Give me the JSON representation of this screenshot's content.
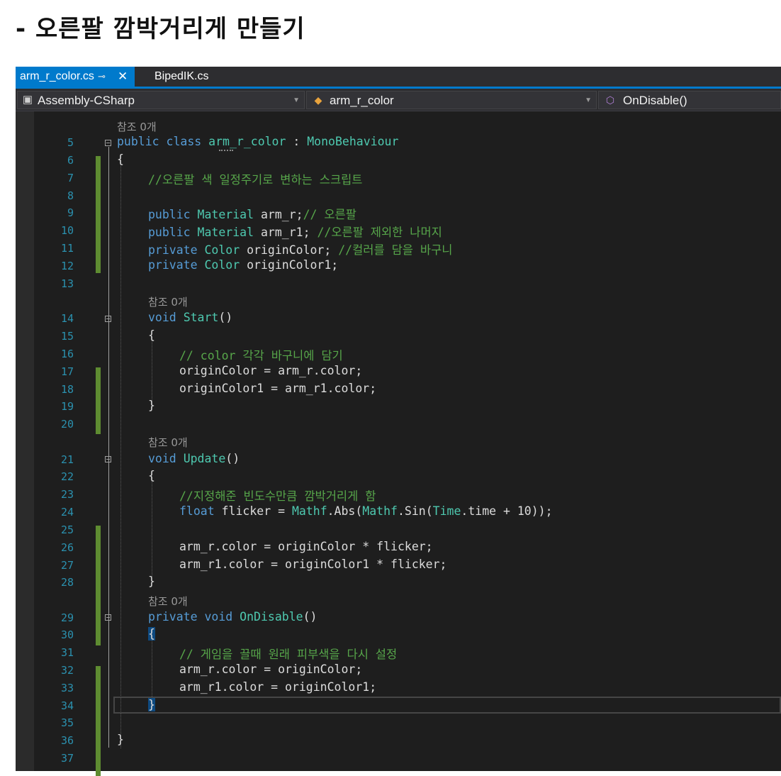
{
  "heading": "- 오른팔 깜박거리게 만들기",
  "tabs": [
    {
      "label": "arm_r_color.cs",
      "pin": "⊸",
      "close": "✕",
      "active": true
    },
    {
      "label": "BipedIK.cs",
      "active": false
    }
  ],
  "nav": {
    "project": "Assembly-CSharp",
    "class": "arm_r_color",
    "member": "OnDisable()"
  },
  "codelens": "참조 0개",
  "line_numbers": [
    "5",
    "6",
    "7",
    "8",
    "9",
    "10",
    "11",
    "12",
    "13",
    "14",
    "15",
    "16",
    "17",
    "18",
    "19",
    "20",
    "21",
    "22",
    "23",
    "24",
    "25",
    "26",
    "27",
    "28",
    "29",
    "30",
    "31",
    "32",
    "33",
    "34",
    "35",
    "36",
    "37"
  ],
  "code": {
    "l5": [
      "public",
      "class",
      "arm_r_color",
      ":",
      "MonoBehaviour"
    ],
    "l6": "{",
    "l7": "//오른팔 색 일정주기로 변하는 스크립트",
    "l9": [
      "public",
      "Material",
      "arm_r;",
      "// 오른팔"
    ],
    "l10": [
      "public",
      "Material",
      "arm_r1;",
      "//오른팔 제외한 나머지"
    ],
    "l11": [
      "private",
      "Color",
      "originColor;",
      "//컬러를 담을 바구니"
    ],
    "l12": [
      "private",
      "Color",
      "originColor1;"
    ],
    "l14": [
      "void",
      "Start",
      "()"
    ],
    "l15": "{",
    "l16": "// color 각각 바구니에 담기",
    "l17": "originColor = arm_r.color;",
    "l18": "originColor1 = arm_r1.color;",
    "l19": "}",
    "l21": [
      "void",
      "Update",
      "()"
    ],
    "l22": "{",
    "l23": "//지정해준 빈도수만큼 깜박거리게 함",
    "l24": [
      "float",
      "flicker = ",
      "Mathf",
      ".Abs(",
      "Mathf",
      ".Sin(",
      "Time",
      ".time + 10));"
    ],
    "l26": "arm_r.color = originColor * flicker;",
    "l27": "arm_r1.color = originColor1 * flicker;",
    "l28": "}",
    "l29": [
      "private",
      "void",
      "OnDisable",
      "()"
    ],
    "l30": "{",
    "l31": "// 게임을 끌때 원래 피부색을 다시 설정",
    "l32": "arm_r.color = originColor;",
    "l33": "arm_r1.color = originColor1;",
    "l34": "}",
    "l36": "}"
  },
  "colors": {
    "keyword": "#569cd6",
    "type": "#4ec9b0",
    "comment": "#57a64a",
    "line_number": "#2b91af",
    "accent": "#007acc",
    "change_bar": "#5e8c31"
  }
}
